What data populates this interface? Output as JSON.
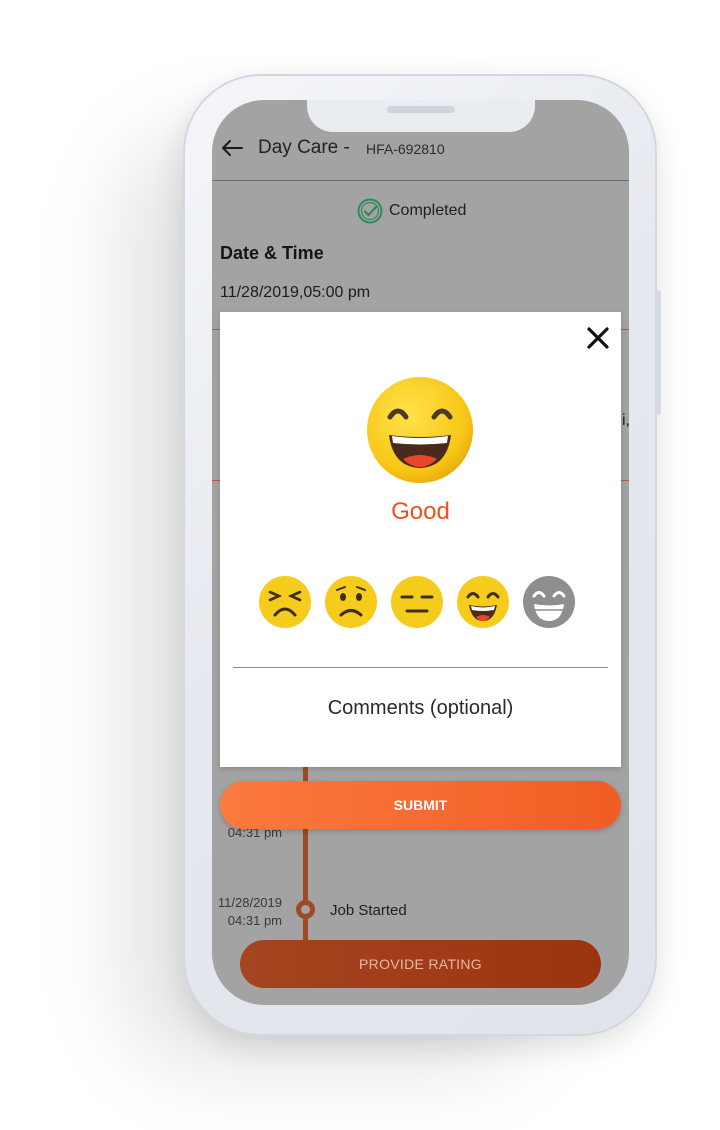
{
  "header": {
    "title": "Day Care -",
    "booking_code": "HFA-692810",
    "back_icon": "arrow-left-icon"
  },
  "status": {
    "icon": "check-circle-icon",
    "label": "Completed",
    "color": "#2e8b57"
  },
  "details": {
    "heading": "Date & Time",
    "datetime": "11/28/2019,05:00 pm",
    "partial_text": "i,"
  },
  "timeline": {
    "entries": [
      {
        "date": "",
        "time": "04:31 pm",
        "label": ""
      },
      {
        "date": "11/28/2019",
        "time": "04:31 pm",
        "label": "Job Started"
      }
    ],
    "color": "#a04a25"
  },
  "provide_rating_button": {
    "label": "PROVIDE RATING"
  },
  "modal": {
    "close_icon": "close-icon",
    "selected_emoji": "grinning-face-icon",
    "selected_label": "Good",
    "label_color": "#f0501a",
    "emoji_options": [
      {
        "name": "very-bad-face-icon",
        "selected": false
      },
      {
        "name": "sad-face-icon",
        "selected": false
      },
      {
        "name": "neutral-face-icon",
        "selected": false
      },
      {
        "name": "happy-face-icon",
        "selected": true
      },
      {
        "name": "excellent-face-icon",
        "selected": false
      }
    ],
    "comments_placeholder": "Comments (optional)",
    "submit_label": "SUBMIT",
    "accent_color": "#f26b2f"
  }
}
